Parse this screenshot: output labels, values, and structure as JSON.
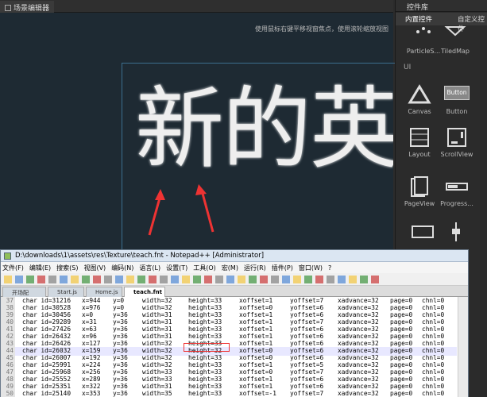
{
  "scene_editor": {
    "tab_label": "场景编辑器",
    "hint": "使用鼠标右键平移视窗焦点，使用滚轮缩放视图",
    "canvas_text": "新的英"
  },
  "controls": {
    "title": "控件库",
    "tabs": [
      "内置控件",
      "自定义控件"
    ],
    "ui_label": "UI",
    "items": [
      {
        "label": "ParticleS...",
        "icon": "particle-icon"
      },
      {
        "label": "TiledMap",
        "icon": "tiledmap-icon"
      },
      {
        "label": "Canvas",
        "icon": "canvas-icon"
      },
      {
        "label": "Button",
        "icon": "button-icon",
        "icon_text": "Button"
      },
      {
        "label": "Layout",
        "icon": "layout-icon"
      },
      {
        "label": "ScrollView",
        "icon": "scrollview-icon"
      },
      {
        "label": "PageView",
        "icon": "pageview-icon"
      },
      {
        "label": "Progress...",
        "icon": "progress-icon"
      }
    ]
  },
  "npp": {
    "title": "D:\\downloads\\1\\assets\\res\\Texture\\teach.fnt - Notepad++ [Administrator]",
    "menu": [
      "文件(F)",
      "编辑(E)",
      "搜索(S)",
      "视图(V)",
      "编码(N)",
      "语言(L)",
      "设置(T)",
      "工具(O)",
      "宏(M)",
      "运行(R)",
      "插件(P)",
      "窗口(W)",
      "?"
    ],
    "tabs": [
      "开场配置.txt",
      "Start.js",
      "Home.js",
      "teach.fnt"
    ],
    "lines": [
      {
        "n": "37",
        "c": [
          "char id=31216",
          "x=944",
          "y=0",
          "width=32",
          "height=33",
          "xoffset=1",
          "yoffset=7",
          "xadvance=32",
          "page=0",
          "chnl=0"
        ]
      },
      {
        "n": "38",
        "c": [
          "char id=30528",
          "x=976",
          "y=0",
          "width=32",
          "height=33",
          "xoffset=0",
          "yoffset=6",
          "xadvance=32",
          "page=0",
          "chnl=0"
        ]
      },
      {
        "n": "39",
        "c": [
          "char id=30456",
          "x=0",
          "y=36",
          "width=31",
          "height=33",
          "xoffset=1",
          "yoffset=6",
          "xadvance=32",
          "page=0",
          "chnl=0"
        ]
      },
      {
        "n": "40",
        "c": [
          "char id=29289",
          "x=31",
          "y=36",
          "width=31",
          "height=33",
          "xoffset=1",
          "yoffset=7",
          "xadvance=32",
          "page=0",
          "chnl=0"
        ]
      },
      {
        "n": "41",
        "c": [
          "char id=27426",
          "x=63",
          "y=36",
          "width=31",
          "height=33",
          "xoffset=1",
          "yoffset=6",
          "xadvance=32",
          "page=0",
          "chnl=0"
        ]
      },
      {
        "n": "42",
        "c": [
          "char id=26432",
          "x=96",
          "y=36",
          "width=31",
          "height=33",
          "xoffset=1",
          "yoffset=6",
          "xadvance=32",
          "page=0",
          "chnl=0"
        ]
      },
      {
        "n": "43",
        "c": [
          "char id=26426",
          "x=127",
          "y=36",
          "width=32",
          "height=33",
          "xoffset=1",
          "yoffset=6",
          "xadvance=32",
          "page=0",
          "chnl=0"
        ]
      },
      {
        "n": "44",
        "c": [
          "char id=26032",
          "x=159",
          "y=36",
          "width=32",
          "height=32",
          "xoffset=0",
          "yoffset=6",
          "xadvance=32",
          "page=0",
          "chnl=0"
        ]
      },
      {
        "n": "45",
        "c": [
          "char id=26007",
          "x=192",
          "y=36",
          "width=32",
          "height=33",
          "xoffset=0",
          "yoffset=6",
          "xadvance=32",
          "page=0",
          "chnl=0"
        ]
      },
      {
        "n": "46",
        "c": [
          "char id=25991",
          "x=224",
          "y=36",
          "width=32",
          "height=33",
          "xoffset=1",
          "yoffset=5",
          "xadvance=32",
          "page=0",
          "chnl=0"
        ]
      },
      {
        "n": "47",
        "c": [
          "char id=25968",
          "x=256",
          "y=36",
          "width=33",
          "height=33",
          "xoffset=0",
          "yoffset=7",
          "xadvance=32",
          "page=0",
          "chnl=0"
        ]
      },
      {
        "n": "48",
        "c": [
          "char id=25552",
          "x=289",
          "y=36",
          "width=33",
          "height=33",
          "xoffset=1",
          "yoffset=6",
          "xadvance=32",
          "page=0",
          "chnl=0"
        ]
      },
      {
        "n": "49",
        "c": [
          "char id=25351",
          "x=322",
          "y=36",
          "width=31",
          "height=33",
          "xoffset=1",
          "yoffset=6",
          "xadvance=32",
          "page=0",
          "chnl=0"
        ]
      },
      {
        "n": "50",
        "c": [
          "char id=25140",
          "x=353",
          "y=36",
          "width=35",
          "height=33",
          "xoffset=-1",
          "yoffset=7",
          "xadvance=32",
          "page=0",
          "chnl=0"
        ]
      }
    ]
  },
  "colors": {
    "accent_red": "#e33",
    "scene_bg": "#1e2a33"
  }
}
